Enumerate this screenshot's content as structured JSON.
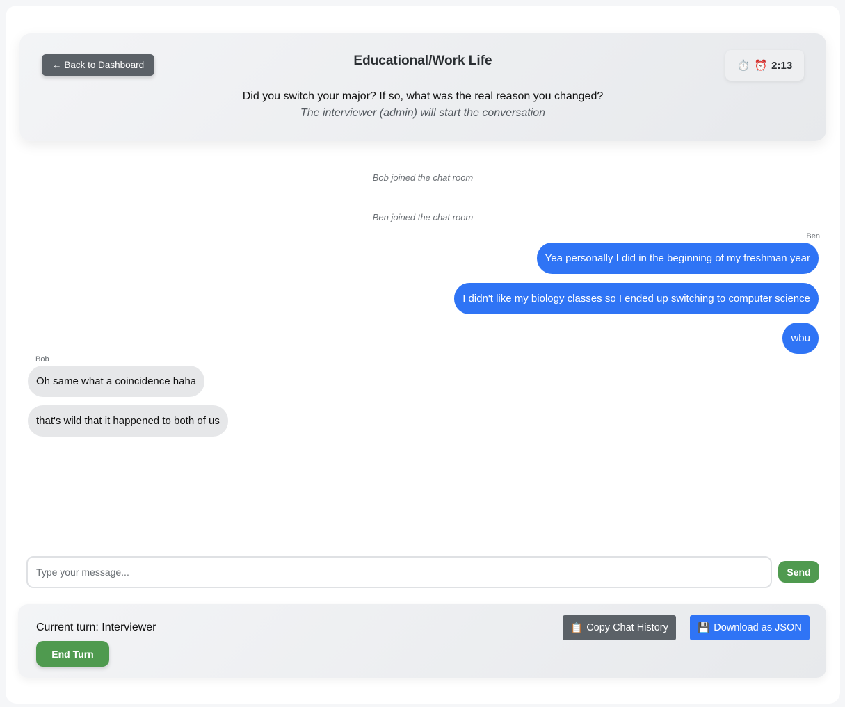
{
  "header": {
    "back_label": "Back to Dashboard",
    "back_arrow": "←",
    "title": "Educational/Work Life",
    "question": "Did you switch your major? If so, what was the real reason you changed?",
    "note": "The interviewer (admin) will start the conversation",
    "timer": {
      "stopwatch_icon": "⏱️",
      "alarm_icon": "⏰",
      "value": "2:13"
    }
  },
  "chat": {
    "system_messages": [
      "Bob joined the chat room",
      "Ben joined the chat room"
    ],
    "outgoing": {
      "sender": "Ben",
      "messages": [
        "Yea personally I did in the beginning of my freshman year",
        "I didn't like my biology classes so I ended up switching to computer science",
        "wbu"
      ]
    },
    "incoming": {
      "sender": "Bob",
      "messages": [
        "Oh same what a coincidence haha",
        "that's wild that it happened to both of us"
      ]
    }
  },
  "composer": {
    "placeholder": "Type your message...",
    "send_label": "Send"
  },
  "footer": {
    "turn_text": "Current turn: Interviewer",
    "end_turn_label": "End Turn",
    "copy_icon": "📋",
    "copy_label": "Copy Chat History",
    "download_icon": "💾",
    "download_label": "Download as JSON"
  },
  "colors": {
    "accent_blue": "#2f74f5",
    "accent_green": "#4f9a4f",
    "neutral_button": "#5b6167"
  }
}
